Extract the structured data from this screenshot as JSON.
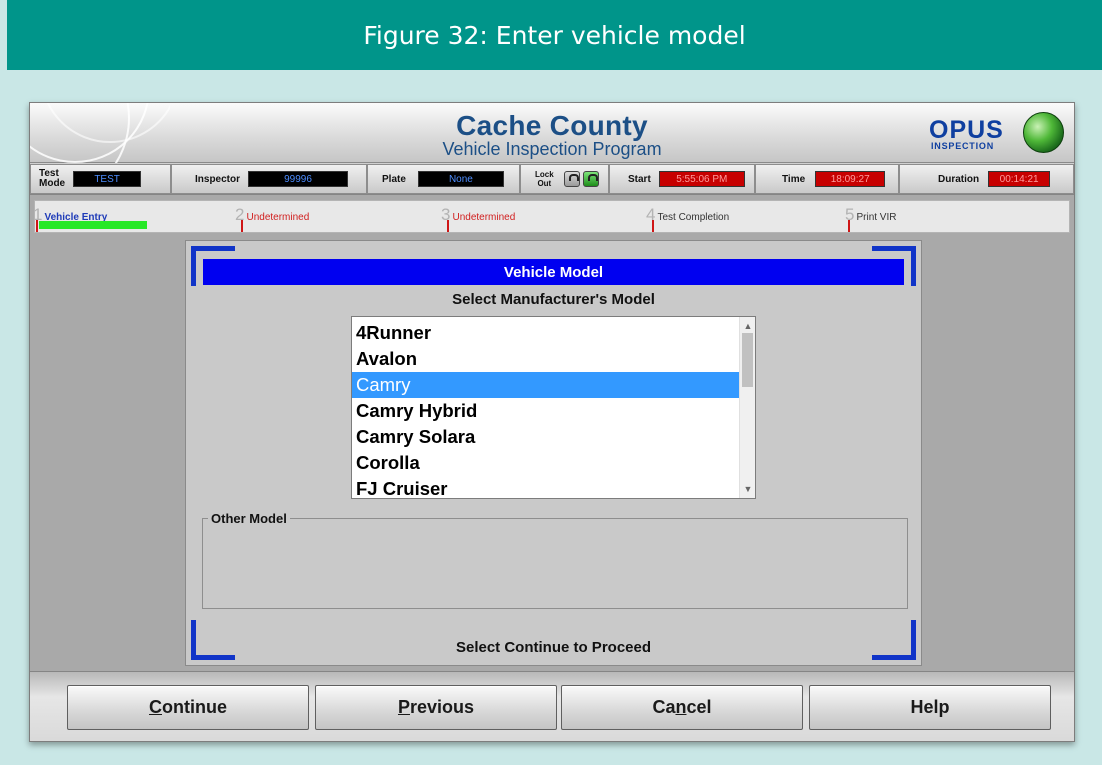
{
  "figure": {
    "caption": "Figure 32: Enter vehicle model"
  },
  "banner": {
    "title": "Cache County",
    "subtitle": "Vehicle Inspection Program",
    "logo_word": "OPUS",
    "logo_sub": "INSPECTION"
  },
  "status": {
    "test_mode": {
      "label_line1": "Test",
      "label_line2": "Mode",
      "value": "TEST"
    },
    "inspector": {
      "label": "Inspector",
      "value": "99996"
    },
    "plate": {
      "label": "Plate",
      "value": "None"
    },
    "lock_out": {
      "label_line1": "Lock",
      "label_line2": "Out"
    },
    "start": {
      "label": "Start",
      "value": "5:55:06 PM"
    },
    "time": {
      "label": "Time",
      "value": "18:09:27"
    },
    "duration": {
      "label": "Duration",
      "value": "00:14:21"
    }
  },
  "steps": [
    {
      "num": "1",
      "name": "Vehicle Entry"
    },
    {
      "num": "2",
      "name": "Undetermined"
    },
    {
      "num": "3",
      "name": "Undetermined"
    },
    {
      "num": "4",
      "name": "Test Completion"
    },
    {
      "num": "5",
      "name": "Print VIR"
    }
  ],
  "progress_fraction": 0.2,
  "panel": {
    "title": "Vehicle Model",
    "subtitle": "Select Manufacturer's Model",
    "models": [
      "4Runner",
      "Avalon",
      "Camry",
      "Camry Hybrid",
      "Camry Solara",
      "Corolla",
      "FJ Cruiser"
    ],
    "selected_model": "Camry",
    "other_model_label": "Other Model",
    "footer": "Select Continue to Proceed"
  },
  "buttons": {
    "continue": {
      "mnemonic": "C",
      "rest": "ontinue"
    },
    "previous": {
      "mnemonic": "P",
      "rest": "revious"
    },
    "cancel": {
      "pre": "Ca",
      "mnemonic": "n",
      "rest": "cel"
    },
    "help": {
      "label": "Help"
    }
  },
  "colors": {
    "figure_header": "#00958a",
    "panel_title_bg": "#0000f0",
    "selection": "#3399ff",
    "progress": "#27e827",
    "tick": "#cf1616"
  }
}
